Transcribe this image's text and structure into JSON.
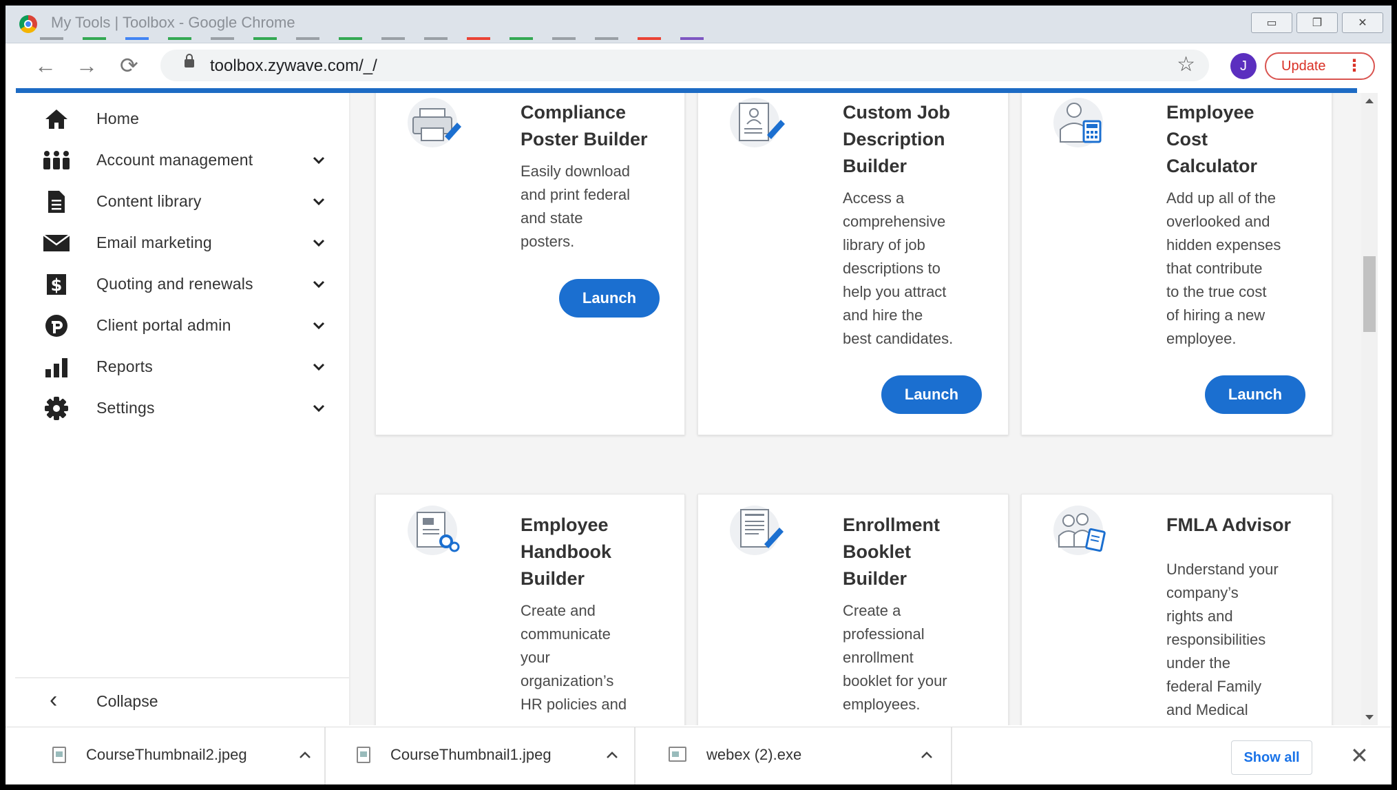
{
  "window": {
    "title": "My Tools | Toolbox - Google Chrome",
    "minimize": "▭",
    "restore": "❐",
    "close": "✕"
  },
  "toolbar": {
    "back": "←",
    "forward": "→",
    "reload": "⟳",
    "url": "toolbox.zywave.com/_/",
    "star": "☆",
    "avatar_initial": "J",
    "update_label": "Update",
    "update_menu": "⋮"
  },
  "sidebar": {
    "items": [
      {
        "label": "Home",
        "icon": "home-icon",
        "expandable": false
      },
      {
        "label": "Account management",
        "icon": "people-icon",
        "expandable": true
      },
      {
        "label": "Content library",
        "icon": "document-icon",
        "expandable": true
      },
      {
        "label": "Email marketing",
        "icon": "envelope-icon",
        "expandable": true
      },
      {
        "label": "Quoting and renewals",
        "icon": "dollar-icon",
        "expandable": true
      },
      {
        "label": "Client portal admin",
        "icon": "portal-icon",
        "expandable": true
      },
      {
        "label": "Reports",
        "icon": "bar-chart-icon",
        "expandable": true
      },
      {
        "label": "Settings",
        "icon": "gear-icon",
        "expandable": true
      }
    ],
    "collapse_label": "Collapse",
    "collapse_glyph": "‹"
  },
  "cards": [
    {
      "title_lines": [
        "Compliance",
        "Poster Builder"
      ],
      "desc_lines": [
        "Easily download",
        "and print federal",
        "and state",
        "posters."
      ],
      "launch": "Launch",
      "icon": "printer-icon"
    },
    {
      "title_lines": [
        "Custom Job",
        "Description",
        "Builder"
      ],
      "desc_lines": [
        "Access a",
        "comprehensive",
        "library of job",
        "descriptions to",
        "help you attract",
        "and hire the",
        "best candidates."
      ],
      "launch": "Launch",
      "icon": "profile-document-icon"
    },
    {
      "title_lines": [
        "Employee",
        "Cost",
        "Calculator"
      ],
      "desc_lines": [
        "Add up all of the",
        "overlooked and",
        "hidden expenses",
        "that contribute",
        "to the true cost",
        "of hiring a new",
        "employee."
      ],
      "launch": "Launch",
      "icon": "person-calculator-icon"
    },
    {
      "title_lines": [
        "Employee",
        "Handbook",
        "Builder"
      ],
      "desc_lines": [
        "Create and",
        "communicate",
        "your",
        "organization’s",
        "HR policies and"
      ],
      "icon": "handbook-gears-icon"
    },
    {
      "title_lines": [
        "Enrollment",
        "Booklet",
        "Builder"
      ],
      "desc_lines": [
        "Create a",
        "professional",
        "enrollment",
        "booklet for your",
        "employees."
      ],
      "icon": "booklet-pen-icon"
    },
    {
      "title_lines": [
        "FMLA Advisor"
      ],
      "desc_lines": [
        "Understand your",
        "company’s",
        "rights and",
        "responsibilities",
        "under the",
        "federal Family",
        "and Medical"
      ],
      "icon": "family-clipboard-icon"
    }
  ],
  "downloads": {
    "items": [
      {
        "name": "CourseThumbnail2.jpeg"
      },
      {
        "name": "CourseThumbnail1.jpeg"
      },
      {
        "name": "webex (2).exe"
      }
    ],
    "show_all": "Show all",
    "close": "✕"
  },
  "colors": {
    "accent": "#1b6fd0",
    "update": "#d93025",
    "avatar": "#5b2fbf"
  }
}
